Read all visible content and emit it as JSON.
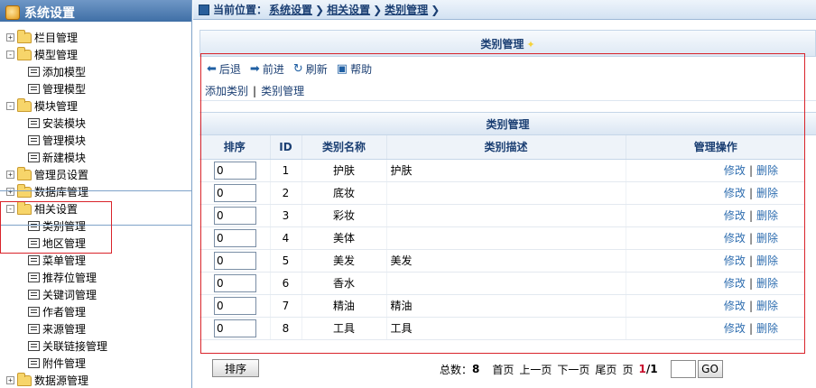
{
  "sidebar": {
    "title": "系统设置",
    "items": [
      {
        "label": "栏目管理",
        "level": 0,
        "type": "folder",
        "toggle": "+"
      },
      {
        "label": "模型管理",
        "level": 0,
        "type": "folder",
        "toggle": "-"
      },
      {
        "label": "添加模型",
        "level": 1,
        "type": "page"
      },
      {
        "label": "管理模型",
        "level": 1,
        "type": "page"
      },
      {
        "label": "模块管理",
        "level": 0,
        "type": "folder",
        "toggle": "-"
      },
      {
        "label": "安装模块",
        "level": 1,
        "type": "page"
      },
      {
        "label": "管理模块",
        "level": 1,
        "type": "page"
      },
      {
        "label": "新建模块",
        "level": 1,
        "type": "page"
      },
      {
        "label": "管理员设置",
        "level": 0,
        "type": "folder",
        "toggle": "+"
      },
      {
        "label": "数据库管理",
        "level": 0,
        "type": "folder",
        "toggle": "+"
      },
      {
        "label": "相关设置",
        "level": 0,
        "type": "folder",
        "toggle": "-"
      },
      {
        "label": "类别管理",
        "level": 1,
        "type": "page"
      },
      {
        "label": "地区管理",
        "level": 1,
        "type": "page"
      },
      {
        "label": "菜单管理",
        "level": 1,
        "type": "page"
      },
      {
        "label": "推荐位管理",
        "level": 1,
        "type": "page"
      },
      {
        "label": "关键词管理",
        "level": 1,
        "type": "page"
      },
      {
        "label": "作者管理",
        "level": 1,
        "type": "page"
      },
      {
        "label": "来源管理",
        "level": 1,
        "type": "page"
      },
      {
        "label": "关联链接管理",
        "level": 1,
        "type": "page"
      },
      {
        "label": "附件管理",
        "level": 1,
        "type": "page"
      },
      {
        "label": "数据源管理",
        "level": 0,
        "type": "folder",
        "toggle": "+"
      }
    ]
  },
  "topbar": {
    "location_label": "当前位置：",
    "breadcrumbs": [
      "系统设置",
      "相关设置",
      "类别管理"
    ]
  },
  "panel": {
    "title": "类别管理",
    "toolbar": {
      "back": "后退",
      "forward": "前进",
      "refresh": "刷新",
      "help": "帮助"
    },
    "links": {
      "add": "添加类别",
      "manage": "类别管理"
    }
  },
  "table": {
    "title": "类别管理",
    "columns": [
      "排序",
      "ID",
      "类别名称",
      "类别描述",
      "管理操作"
    ],
    "rows": [
      {
        "sort": "0",
        "id": "1",
        "name": "护肤",
        "desc": "护肤"
      },
      {
        "sort": "0",
        "id": "2",
        "name": "底妆",
        "desc": ""
      },
      {
        "sort": "0",
        "id": "3",
        "name": "彩妆",
        "desc": ""
      },
      {
        "sort": "0",
        "id": "4",
        "name": "美体",
        "desc": ""
      },
      {
        "sort": "0",
        "id": "5",
        "name": "美发",
        "desc": "美发"
      },
      {
        "sort": "0",
        "id": "6",
        "name": "香水",
        "desc": ""
      },
      {
        "sort": "0",
        "id": "7",
        "name": "精油",
        "desc": "精油"
      },
      {
        "sort": "0",
        "id": "8",
        "name": "工具",
        "desc": "工具"
      }
    ],
    "op_edit": "修改",
    "op_sep": "|",
    "op_delete": "删除"
  },
  "footer": {
    "sort_button": "排序",
    "total_label": "总数：",
    "total": "8",
    "first": "首页",
    "prev": "上一页",
    "next": "下一页",
    "last": "尾页",
    "page_label": "页",
    "current_page": "1",
    "total_pages": "/1",
    "go": "GO"
  },
  "colors": {
    "accent": "#1b3f73",
    "highlight": "#d9232a",
    "link": "#2f6eb0"
  }
}
